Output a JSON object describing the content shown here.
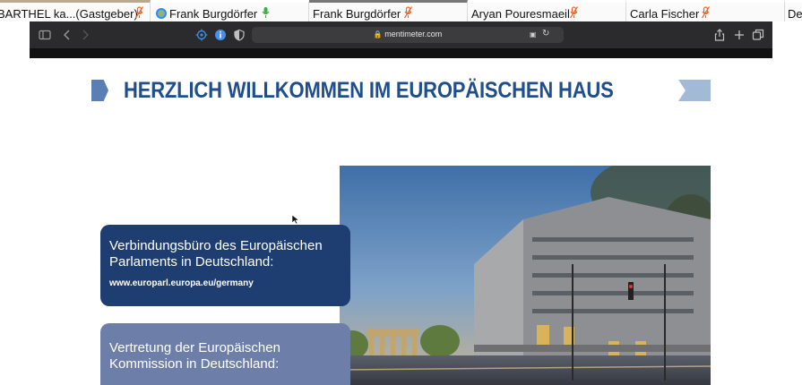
{
  "participants": [
    {
      "name": "BARTHEL ka...(Gastgeber)",
      "mic": "muted"
    },
    {
      "name": "Frank Burgdörfer",
      "mic": "active"
    },
    {
      "name": "Frank Burgdörfer",
      "mic": "muted"
    },
    {
      "name": "Aryan Pouresmaeil",
      "mic": "muted"
    },
    {
      "name": "Carla Fischer",
      "mic": "muted"
    },
    {
      "name": "De",
      "mic": "none"
    }
  ],
  "browser": {
    "url": "mentimeter.com"
  },
  "slide": {
    "title": "HERZLICH WILLKOMMEN IM EUROPÄISCHEN HAUS",
    "box1": {
      "title": "Verbindungsbüro des Europäischen Parlaments in Deutschland:",
      "link": "www.europarl.europa.eu/germany"
    },
    "box2": {
      "title": "Vertretung der Europäischen Kommission in Deutschland:"
    }
  },
  "colors": {
    "title": "#1f4e8c",
    "box1": "#1e3e72",
    "box2": "#6d7fa8",
    "toolbar": "#2b2b2d",
    "mic_muted": "#e8692a",
    "mic_active": "#3cb043"
  }
}
